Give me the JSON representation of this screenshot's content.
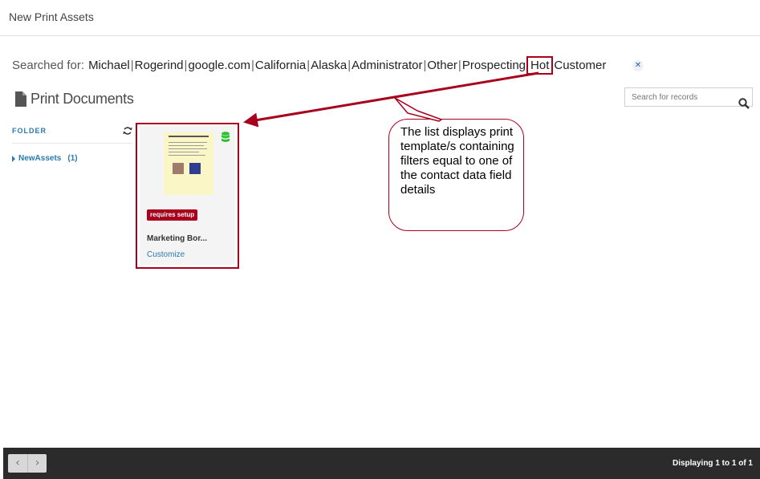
{
  "header": {
    "title": "New Print Assets"
  },
  "search_summary": {
    "prefix": "Searched for:",
    "terms": [
      "Michael",
      "Rogerind",
      "google.com",
      "California",
      "Alaska",
      "Administrator",
      "Other",
      "Prospecting",
      "Hot",
      "Customer"
    ],
    "separator": "|",
    "highlighted_term": "Hot",
    "clear_icon": "close-icon"
  },
  "section": {
    "title": "Print Documents",
    "icon": "document-icon"
  },
  "search": {
    "placeholder": "Search for records",
    "icon": "search-icon"
  },
  "folders": {
    "label": "FOLDER",
    "refresh_icon": "refresh-icon",
    "items": [
      {
        "name": "NewAssets",
        "count": "(1)"
      }
    ]
  },
  "documents": [
    {
      "name": "Marketing Bor...",
      "badge": "requires setup",
      "action": "Customize",
      "thumbnail_title": "Types of Bees Bags",
      "status_icon": "database-icon"
    }
  ],
  "annotation": {
    "text": "The list displays print template/s containing filters equal to one of the contact data field details",
    "highlight_color": "#a8001c"
  },
  "footer": {
    "status": "Displaying 1 to 1 of 1",
    "prev_label": "‹",
    "next_label": "›"
  },
  "colors": {
    "accent": "#2a7ab0",
    "badge": "#a8001c",
    "footer_bg": "#2b2b2b"
  }
}
